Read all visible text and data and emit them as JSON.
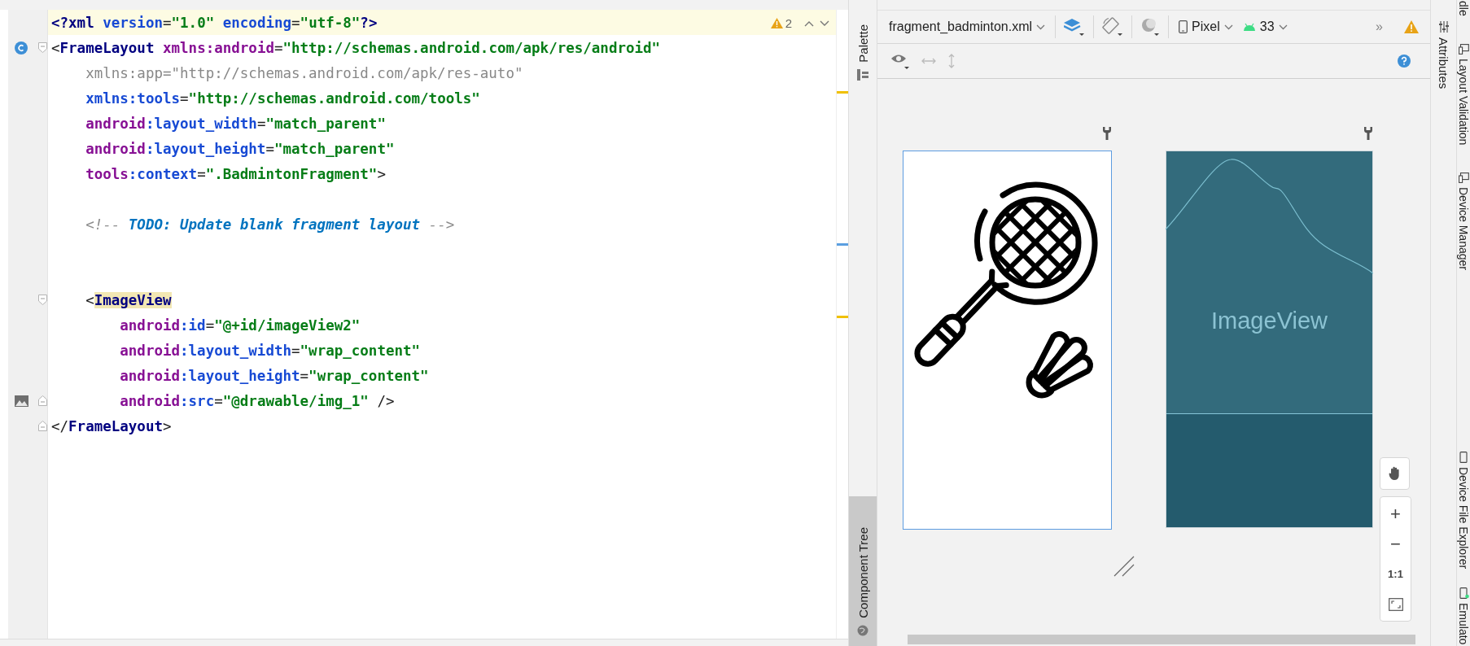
{
  "editor": {
    "lines": [
      {
        "kind": "code",
        "current": true,
        "tokens": [
          {
            "kind": "tag",
            "text": "<?xml"
          },
          {
            "kind": "attr",
            "text": " version"
          },
          {
            "kind": "punct",
            "text": "="
          },
          {
            "kind": "value",
            "text": "\"1.0\""
          },
          {
            "kind": "attr",
            "text": " encoding"
          },
          {
            "kind": "punct",
            "text": "="
          },
          {
            "kind": "value",
            "text": "\"utf-8\""
          },
          {
            "kind": "tag",
            "text": "?>"
          }
        ]
      },
      {
        "kind": "code",
        "current": false,
        "gutter": {
          "kind": "class"
        },
        "fold": {
          "kind": "start"
        },
        "tokens": [
          {
            "kind": "punct",
            "text": "<"
          },
          {
            "kind": "tag",
            "text": "FrameLayout"
          },
          {
            "kind": "ns",
            "text": " xmlns:android"
          },
          {
            "kind": "punct",
            "text": "="
          },
          {
            "kind": "value",
            "text": "\"http://schemas.android.com/apk/res/android\""
          }
        ]
      },
      {
        "kind": "code",
        "current": false,
        "tokens": [
          {
            "kind": "unused",
            "text": "    xmlns:app=\"http://schemas.android.com/apk/res-auto\""
          }
        ]
      },
      {
        "kind": "code",
        "current": false,
        "tokens": [
          {
            "kind": "attr",
            "text": "    xmlns:tools"
          },
          {
            "kind": "punct",
            "text": "="
          },
          {
            "kind": "value",
            "text": "\"http://schemas.android.com/tools\""
          }
        ]
      },
      {
        "kind": "code",
        "current": false,
        "tokens": [
          {
            "kind": "ns",
            "text": "    android"
          },
          {
            "kind": "attr",
            "text": ":layout_width"
          },
          {
            "kind": "punct",
            "text": "="
          },
          {
            "kind": "value",
            "text": "\"match_parent\""
          }
        ]
      },
      {
        "kind": "code",
        "current": false,
        "tokens": [
          {
            "kind": "ns",
            "text": "    android"
          },
          {
            "kind": "attr",
            "text": ":layout_height"
          },
          {
            "kind": "punct",
            "text": "="
          },
          {
            "kind": "value",
            "text": "\"match_parent\""
          }
        ]
      },
      {
        "kind": "code",
        "current": false,
        "tokens": [
          {
            "kind": "ns",
            "text": "    tools"
          },
          {
            "kind": "attr",
            "text": ":context"
          },
          {
            "kind": "punct",
            "text": "="
          },
          {
            "kind": "value",
            "text": "\".BadmintonFragment\""
          },
          {
            "kind": "punct",
            "text": ">"
          }
        ]
      },
      {
        "kind": "blank",
        "current": false
      },
      {
        "kind": "code",
        "current": false,
        "tokens": [
          {
            "kind": "comment",
            "text": "    <!-- "
          },
          {
            "kind": "todo",
            "text": "TODO: Update blank fragment layout"
          },
          {
            "kind": "comment",
            "text": " -->"
          }
        ]
      },
      {
        "kind": "blank",
        "current": false
      },
      {
        "kind": "blank",
        "current": false
      },
      {
        "kind": "code",
        "current": false,
        "fold": {
          "kind": "start"
        },
        "tokens": [
          {
            "kind": "punct",
            "text": "    <"
          },
          {
            "kind": "tag_hl",
            "text": "ImageView"
          }
        ]
      },
      {
        "kind": "code",
        "current": false,
        "tokens": [
          {
            "kind": "ns",
            "text": "        android"
          },
          {
            "kind": "attr",
            "text": ":id"
          },
          {
            "kind": "punct",
            "text": "="
          },
          {
            "kind": "value",
            "text": "\"@+id/imageView2\""
          }
        ]
      },
      {
        "kind": "code",
        "current": false,
        "tokens": [
          {
            "kind": "ns",
            "text": "        android"
          },
          {
            "kind": "attr",
            "text": ":layout_width"
          },
          {
            "kind": "punct",
            "text": "="
          },
          {
            "kind": "value",
            "text": "\"wrap_content\""
          }
        ]
      },
      {
        "kind": "code",
        "current": false,
        "tokens": [
          {
            "kind": "ns",
            "text": "        android"
          },
          {
            "kind": "attr",
            "text": ":layout_height"
          },
          {
            "kind": "punct",
            "text": "="
          },
          {
            "kind": "value",
            "text": "\"wrap_content\""
          }
        ]
      },
      {
        "kind": "code",
        "current": false,
        "gutter": {
          "kind": "image"
        },
        "fold": {
          "kind": "end"
        },
        "tokens": [
          {
            "kind": "ns",
            "text": "        android"
          },
          {
            "kind": "attr",
            "text": ":src"
          },
          {
            "kind": "punct",
            "text": "="
          },
          {
            "kind": "value",
            "text": "\"@drawable/img_1\""
          },
          {
            "kind": "punct",
            "text": " />"
          }
        ]
      },
      {
        "kind": "code",
        "current": false,
        "fold": {
          "kind": "end"
        },
        "tokens": [
          {
            "kind": "punct",
            "text": "</"
          },
          {
            "kind": "tag",
            "text": "FrameLayout"
          },
          {
            "kind": "punct",
            "text": ">"
          }
        ]
      }
    ],
    "warning_count": "2"
  },
  "design": {
    "left_tabs": [
      {
        "label": "Palette"
      },
      {
        "label": "Component Tree"
      }
    ],
    "toolbar": {
      "file": "fragment_badminton.xml",
      "device": "Pixel",
      "api": "33",
      "overflow": "»"
    },
    "blueprint_label": "ImageView",
    "zoom_controls": {
      "zoom_in": "+",
      "zoom_out": "−",
      "actual_size": "1:1"
    }
  },
  "right_strip": {
    "attributes": "Attributes",
    "top_tools": [
      "dle",
      "Layout Validation",
      "Device Manager"
    ],
    "bottom_tools": [
      "Device File Explorer",
      "Emulato"
    ]
  }
}
